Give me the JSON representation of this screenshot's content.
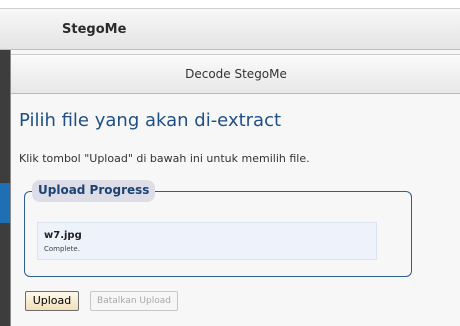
{
  "app": {
    "title": "StegoMe"
  },
  "dialog": {
    "title": "Decode StegoMe",
    "heading": "Pilih file yang akan di-extract",
    "instruction": "Klik tombol \"Upload\" di bawah ini untuk memilih file."
  },
  "progress": {
    "legend": "Upload Progress",
    "file_name": "w7.jpg",
    "status": "Complete."
  },
  "buttons": {
    "upload": "Upload",
    "cancel": "Batalkan Upload"
  },
  "colors": {
    "heading": "#1f4f86",
    "border": "#2f5e93",
    "file_box": "#eef2fb",
    "left_accent": "#1f6fb5"
  }
}
